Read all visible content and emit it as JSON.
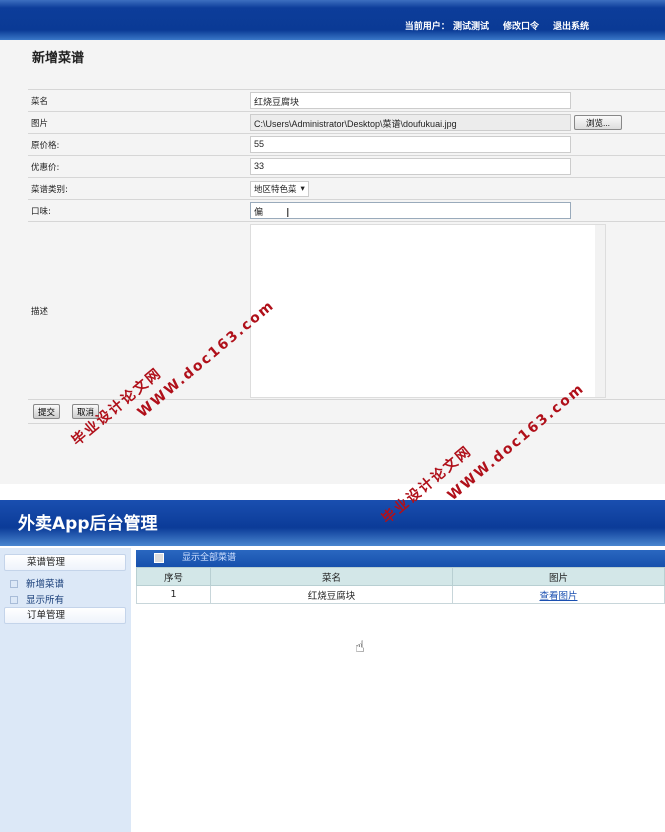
{
  "top": {
    "current_user_label": "当前用户：",
    "user_name": "测试测试",
    "change_password": "修改口令",
    "logout": "退出系统"
  },
  "form": {
    "title": "新增菜谱",
    "fields": [
      {
        "label": "菜名",
        "value": "红烧豆腐块"
      },
      {
        "label": "图片",
        "value": "C:\\Users\\Administrator\\Desktop\\菜谱\\doufukuai.jpg",
        "button": "浏览..."
      },
      {
        "label": "原价格:",
        "value": "55"
      },
      {
        "label": "优惠价:",
        "value": "33"
      },
      {
        "label": "菜谱类别:",
        "value": "地区特色菜"
      },
      {
        "label": "口味:",
        "value": "偏"
      },
      {
        "label": "描述",
        "value": ""
      }
    ],
    "submit": "提交",
    "cancel": "取消"
  },
  "admin": {
    "app_title": "外卖App后台管理",
    "sidebar": [
      {
        "label": "菜谱管理"
      },
      {
        "label": "新增菜谱"
      },
      {
        "label": "显示所有"
      },
      {
        "label": "订单管理"
      }
    ],
    "section_title": "显示全部菜谱",
    "table": {
      "headers": [
        "序号",
        "菜名",
        "图片"
      ],
      "rows": [
        [
          "1",
          "红烧豆腐块",
          "查看图片"
        ]
      ]
    }
  },
  "watermark": {
    "cn": "毕业设计论文网",
    "url": "WWW.doc163.com",
    "color": "#b0101a"
  }
}
